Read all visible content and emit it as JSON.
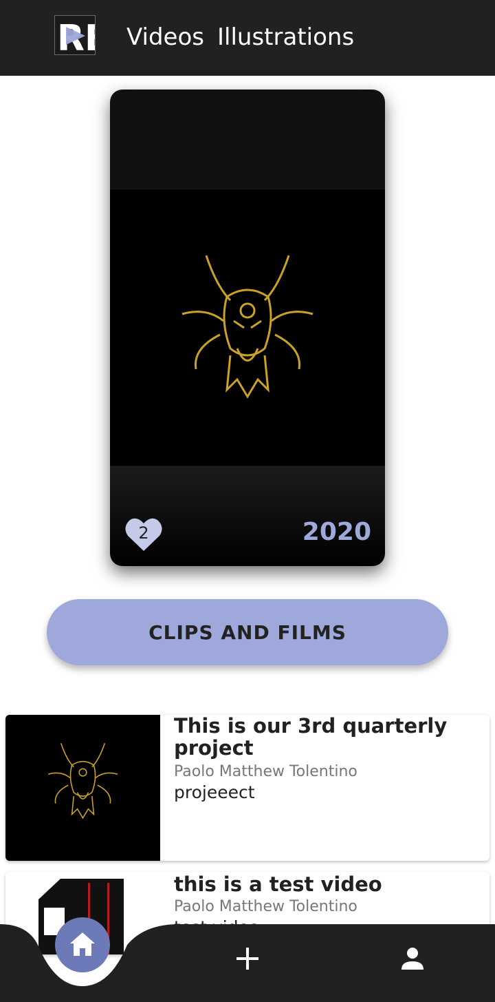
{
  "header": {
    "logo_text": "RE",
    "nav": [
      {
        "label": "Videos"
      },
      {
        "label": "Illustrations"
      }
    ]
  },
  "feature": {
    "likes": "2",
    "year": "2020"
  },
  "clips_button": {
    "label": "CLIPS AND FILMS"
  },
  "videos": [
    {
      "title": "This is our 3rd quarterly project",
      "author": "Paolo Matthew Tolentino",
      "description": "projeeect"
    },
    {
      "title": "this is a test video",
      "author": "Paolo Matthew Tolentino",
      "description": "test video"
    }
  ],
  "colors": {
    "header_bg": "#212121",
    "accent": "#9fa8da",
    "home_button": "#6d7ab8",
    "dragon_gold": "#c9a227"
  },
  "icons": {
    "like": "heart-icon",
    "home": "home-icon",
    "add": "plus-icon",
    "profile": "person-icon"
  }
}
